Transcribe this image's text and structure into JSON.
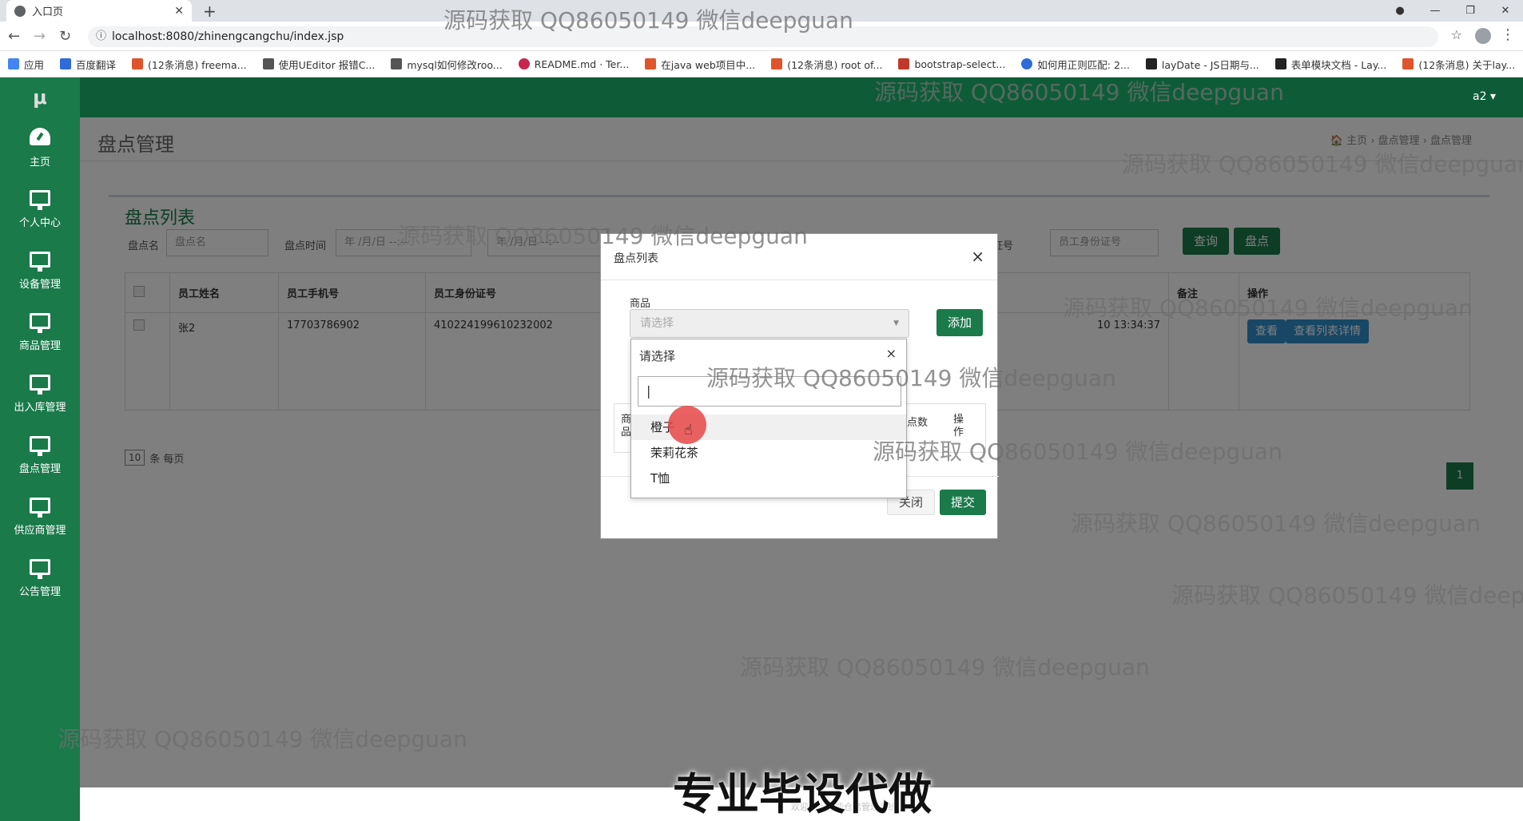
{
  "browser": {
    "tab_title": "入口页",
    "url": "localhost:8080/zhinengcangchu/index.jsp",
    "bookmarks": [
      "应用",
      "百度翻译",
      "(12条消息) freema...",
      "使用UEditor 报错C...",
      "mysql如何修改roo...",
      "README.md · Ter...",
      "在java web项目中...",
      "(12条消息) root of...",
      "bootstrap-select...",
      "如何用正则匹配: 2...",
      "layDate - JS日期与...",
      "表单模块文档 - Lay...",
      "(12条消息) 关于lay..."
    ]
  },
  "app": {
    "logo": "μ",
    "user": "a2 ▾",
    "page_title": "盘点管理",
    "breadcrumb": "🏠 主页  ›  盘点管理  ›  盘点管理"
  },
  "sidebar": {
    "items": [
      {
        "label": "主页",
        "icon": "dashboard-icon"
      },
      {
        "label": "个人中心",
        "icon": "monitor-icon"
      },
      {
        "label": "设备管理",
        "icon": "monitor-icon"
      },
      {
        "label": "商品管理",
        "icon": "monitor-icon"
      },
      {
        "label": "出入库管理",
        "icon": "monitor-icon"
      },
      {
        "label": "盘点管理",
        "icon": "monitor-icon"
      },
      {
        "label": "供应商管理",
        "icon": "monitor-icon"
      },
      {
        "label": "公告管理",
        "icon": "monitor-icon"
      }
    ]
  },
  "list": {
    "title": "盘点列表",
    "filters": {
      "name_label": "盘点名",
      "name_placeholder": "盘点名",
      "time_label": "盘点时间",
      "date_placeholder": "年 /月/日 --:--",
      "idcard_label": "身份证号",
      "idcard_placeholder": "员工身份证号"
    },
    "query_button": "查询",
    "stocktake_button": "盘点",
    "columns": [
      "员工姓名",
      "员工手机号",
      "员工身份证号",
      "备注",
      "操作"
    ],
    "rows": [
      {
        "name": "张2",
        "phone": "17703786902",
        "idcard": "410224199610232002",
        "time": "10 13:34:37",
        "view": "查看",
        "detail": "查看列表详情"
      }
    ],
    "page_size": "10",
    "page_size_suffix": "条 每页",
    "current_page": "1"
  },
  "modal": {
    "title": "盘点列表",
    "product_label": "商品",
    "select_placeholder": "请选择",
    "add_button": "添加",
    "bg_col_count": "点数",
    "bg_col_op": "操作",
    "bg_col_product": "商品",
    "close_button": "关闭",
    "submit_button": "提交",
    "dropdown": {
      "header": "请选择",
      "search_value": "|",
      "options": [
        "橙子",
        "茉莉花茶",
        "T恤"
      ]
    }
  },
  "overlay": {
    "watermark": "源码获取 QQ86050149 微信deepguan",
    "caption": "专业毕设代做",
    "footer": "欢迎使用智能仓储管理系统"
  },
  "colors": {
    "primary": "#1a7a4a",
    "topbar": "#0e5c37",
    "info": "#2f8fc9"
  }
}
